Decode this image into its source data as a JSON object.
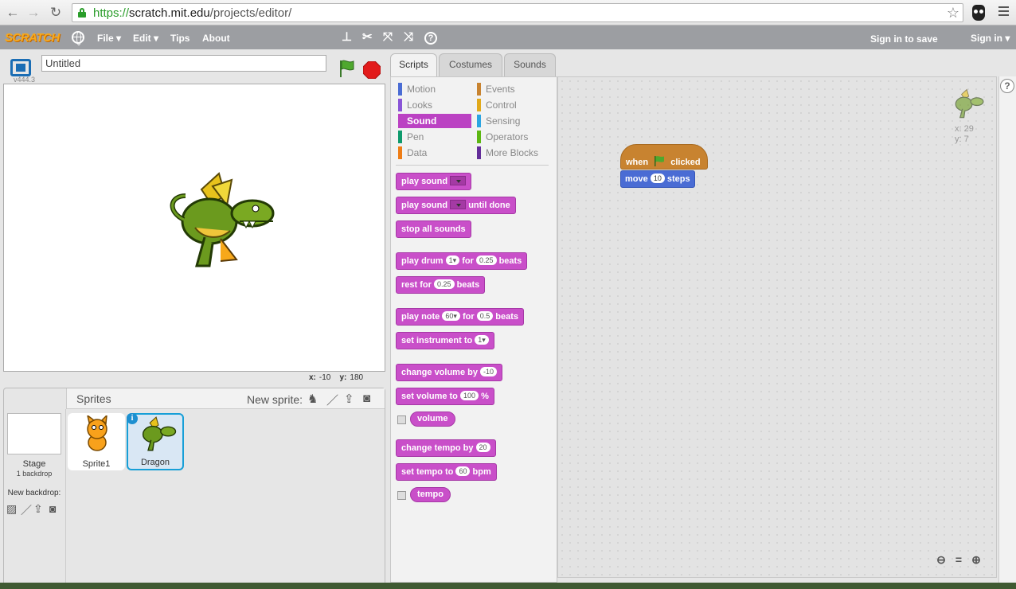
{
  "browser": {
    "url_scheme": "https://",
    "url_host": "scratch.mit.edu",
    "url_path": "/projects/editor/"
  },
  "topbar": {
    "logo": "SCRATCH",
    "menus": [
      "File ▾",
      "Edit ▾",
      "Tips",
      "About"
    ],
    "sign_in_save": "Sign in to save",
    "sign_in": "Sign in ▾"
  },
  "stage": {
    "version": "v444.3",
    "project_title": "Untitled",
    "x_label": "x:",
    "x_value": "-10",
    "y_label": "y:",
    "y_value": "180"
  },
  "sprite_pane": {
    "header": "Sprites",
    "new_sprite": "New sprite:",
    "stage_label": "Stage",
    "stage_sub": "1 backdrop",
    "new_backdrop": "New backdrop:",
    "sprites": [
      {
        "name": "Sprite1",
        "selected": false
      },
      {
        "name": "Dragon",
        "selected": true
      }
    ]
  },
  "tabs": [
    "Scripts",
    "Costumes",
    "Sounds"
  ],
  "categories": [
    {
      "label": "Motion",
      "color": "#4a6cd4"
    },
    {
      "label": "Events",
      "color": "#c88330"
    },
    {
      "label": "Looks",
      "color": "#8a55d7"
    },
    {
      "label": "Control",
      "color": "#e1a91a"
    },
    {
      "label": "Sound",
      "color": "#bb42c3",
      "selected": true
    },
    {
      "label": "Sensing",
      "color": "#2ca5e2"
    },
    {
      "label": "Pen",
      "color": "#0e9a6c"
    },
    {
      "label": "Operators",
      "color": "#5cb712"
    },
    {
      "label": "Data",
      "color": "#ee7d16"
    },
    {
      "label": "More Blocks",
      "color": "#632d99"
    }
  ],
  "blocks": {
    "play_sound": "play sound",
    "play_sound_until": "play sound",
    "until_done": "until done",
    "stop_all": "stop all sounds",
    "play_drum": "play drum",
    "drum_val": "1▾",
    "for": "for",
    "drum_beats": "0.25",
    "beats": "beats",
    "rest_for": "rest for",
    "rest_beats": "0.25",
    "play_note": "play note",
    "note_val": "60▾",
    "note_beats": "0.5",
    "set_instrument": "set instrument to",
    "instrument_val": "1▾",
    "change_volume": "change volume by",
    "volume_delta": "-10",
    "set_volume": "set volume to",
    "volume_val": "100",
    "percent": "%",
    "volume_reporter": "volume",
    "change_tempo": "change tempo by",
    "tempo_delta": "20",
    "set_tempo": "set tempo to",
    "tempo_val": "60",
    "bpm": "bpm",
    "tempo_reporter": "tempo"
  },
  "script": {
    "when": "when",
    "clicked": "clicked",
    "move": "move",
    "steps_val": "10",
    "steps": "steps"
  },
  "sprite_info": {
    "x": "x: 29",
    "y": "y: 7"
  }
}
